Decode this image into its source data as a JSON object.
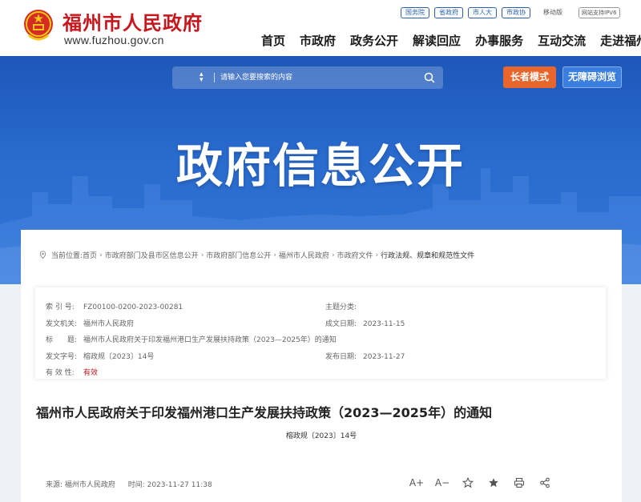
{
  "header": {
    "site_title": "福州市人民政府",
    "site_url": "www.fuzhou.gov.cn",
    "quick_links": [
      "国务院",
      "省政府",
      "市人大",
      "市政协"
    ],
    "mobile_label": "移动版",
    "ipv6_label": "网站支持IPV6",
    "nav": [
      "首页",
      "市政府",
      "政务公开",
      "解读回应",
      "办事服务",
      "互动交流",
      "走进福州"
    ]
  },
  "banner": {
    "search_placeholder": "请输入您要搜索的内容",
    "elder_mode_label": "长者模式",
    "accessibility_label": "无障碍浏览",
    "title": "政府信息公开"
  },
  "breadcrumb": {
    "prefix": "当前位置:",
    "items": [
      "首页",
      "市政府部门及县市区信息公开",
      "市政府部门信息公开",
      "福州市人民政府",
      "市政府文件",
      "行政法规、规章和规范性文件"
    ]
  },
  "meta": {
    "index_label": "索 引 号:",
    "index_value": "FZ00100-0200-2023-00281",
    "topic_label": "主题分类:",
    "topic_value": "",
    "issuer_label": "发文机关:",
    "issuer_value": "福州市人民政府",
    "created_label": "成文日期:",
    "created_value": "2023-11-15",
    "title_label": "标　　题:",
    "title_value": "福州市人民政府关于印发福州港口生产发展扶持政策（2023—2025年）的通知",
    "docno_label": "发文字号:",
    "docno_value": "榕政规〔2023〕14号",
    "published_label": "发布日期:",
    "published_value": "2023-11-27",
    "validity_label": "有 效 性:",
    "validity_value": "有效"
  },
  "document": {
    "title": "福州市人民政府关于印发福州港口生产发展扶持政策（2023—2025年）的通知",
    "number": "榕政规〔2023〕14号",
    "source_label": "来源:",
    "source_value": "福州市人民政府",
    "time_label": "时间:",
    "time_value": "2023-11-27 11:38"
  },
  "tools": {
    "font_larger": "A+",
    "font_smaller": "A−"
  },
  "colors": {
    "brand_red": "#c8161d",
    "banner_blue": "#2a6cd0",
    "elder_orange": "#e8662c",
    "link_blue": "#2a5fb0"
  }
}
